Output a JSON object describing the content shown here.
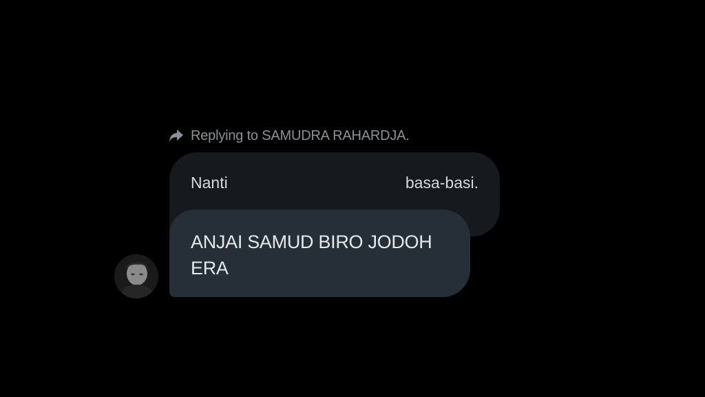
{
  "reply": {
    "icon": "reply-arrow-icon",
    "text": "Replying to SAMUDRA RAHARDJA."
  },
  "quoted_message": {
    "text_left": "Nanti",
    "text_right": "basa-basi."
  },
  "message": {
    "text": "ANJAI SAMUD BIRO JODOH ERA"
  },
  "avatar": {
    "icon": "user-avatar"
  },
  "colors": {
    "background": "#000000",
    "quoted_bubble": "#16191d",
    "message_bubble": "#262f38",
    "secondary_text": "#8b9199",
    "primary_text": "#e6e8ea"
  }
}
